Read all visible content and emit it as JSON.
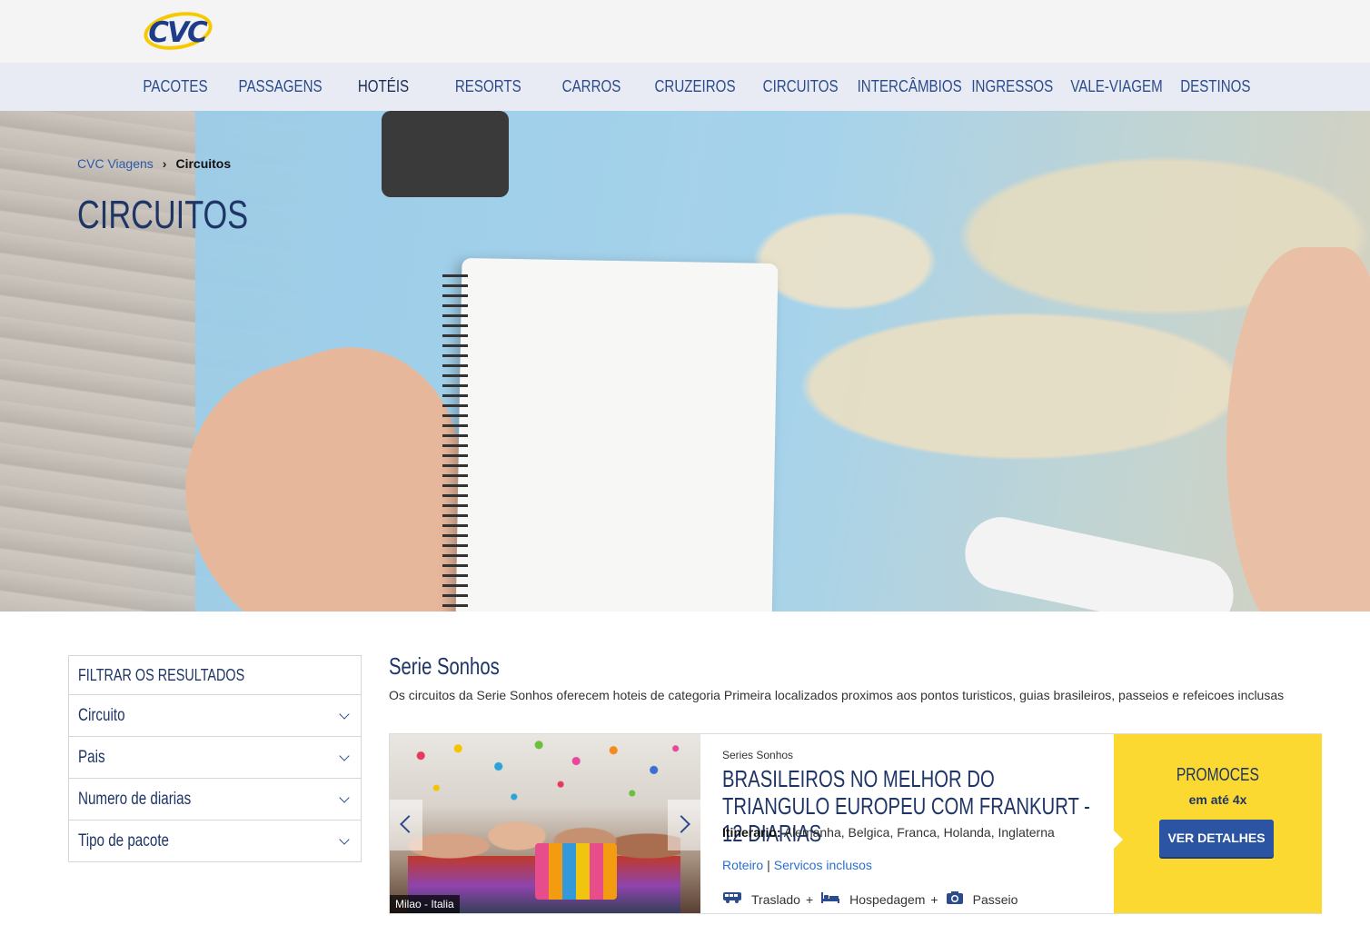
{
  "brand": {
    "logo_text": "CVC"
  },
  "nav": {
    "items": [
      {
        "label": "PACOTES"
      },
      {
        "label": "PASSAGENS"
      },
      {
        "label": "HOTÉIS"
      },
      {
        "label": "RESORTS"
      },
      {
        "label": "CARROS"
      },
      {
        "label": "CRUZEIROS"
      },
      {
        "label": "CIRCUITOS"
      },
      {
        "label": "INTERCÂMBIOS"
      },
      {
        "label": "INGRESSOS"
      },
      {
        "label": "VALE-VIAGEM"
      },
      {
        "label": "DESTINOS"
      }
    ],
    "active_index": 2
  },
  "breadcrumb": {
    "home": "CVC Viagens",
    "separator": "›",
    "current": "Circuitos"
  },
  "hero": {
    "title": "CIRCUITOS"
  },
  "filter": {
    "heading": "FILTRAR OS RESULTADOS",
    "rows": [
      {
        "label": "Circuito"
      },
      {
        "label": "Pais"
      },
      {
        "label": "Numero de diarias"
      },
      {
        "label": "Tipo de pacote"
      }
    ]
  },
  "series": {
    "title": "Serie Sonhos",
    "description": "Os circuitos da Serie Sonhos oferecem hoteis de categoria Primeira localizados proximos aos pontos turisticos, guias brasileiros, passeios e refeicoes inclusas"
  },
  "card": {
    "photo_caption": "Milao - Italia",
    "series_label": "Series Sonhos",
    "title": "BRASILEIROS NO MELHOR DO TRIANGULO EUROPEU COM FRANKURT - 12 DIARIAS",
    "itinerary_label": "Itinerario:",
    "itinerary_value": "Alemanha, Belgica, Franca, Holanda, Inglaterna",
    "link_roteiro": "Roteiro",
    "link_servicos": "Servicos inclusos",
    "services": [
      {
        "icon": "bus-icon",
        "label": "Traslado",
        "plus": "+"
      },
      {
        "icon": "bed-icon",
        "label": "Hospedagem",
        "plus": "+"
      },
      {
        "icon": "camera-icon",
        "label": "Passeio",
        "plus": ""
      }
    ],
    "promo_title": "PROMOCES",
    "promo_sub": "em até 4x",
    "promo_button": "VER DETALHES"
  },
  "colors": {
    "navy": "#1f3566",
    "nav_bg": "#e8ebf4",
    "link_blue": "#2b6fd1",
    "promo_yellow": "#fcd930",
    "button_blue": "#2b55a3",
    "logo_yellow": "#f7c900"
  }
}
